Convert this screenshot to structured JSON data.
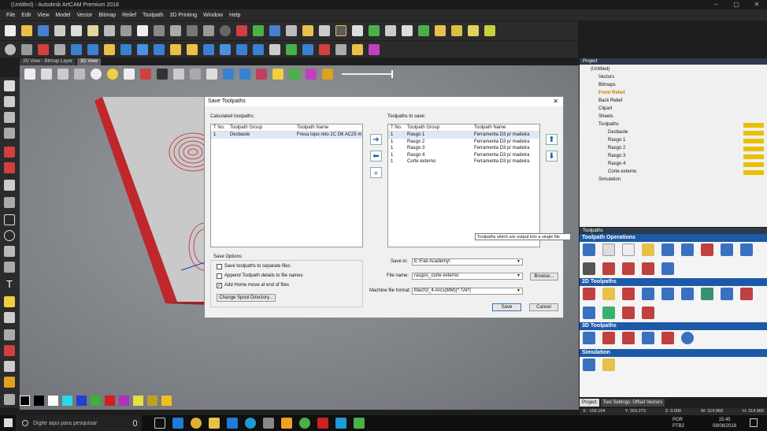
{
  "window": {
    "title": "(Untitled) - Autodesk ArtCAM Premium 2018"
  },
  "menu": [
    "File",
    "Edit",
    "View",
    "Model",
    "Vector",
    "Bitmap",
    "Relief",
    "Toolpath",
    "3D Printing",
    "Window",
    "Help"
  ],
  "view_tabs": [
    "2D View - Bitmap Layer",
    "3D View"
  ],
  "project": {
    "header": "Project",
    "items": [
      "(Untitled)",
      "Vectors",
      "Bitmaps",
      "Front Relief",
      "Back Relief",
      "Clipart",
      "Sheets",
      "Toolpaths",
      "Desbaste",
      "Rasgo 1",
      "Rasgo 2",
      "Rasgo 3",
      "Rasgo 4",
      "Corte externo",
      "Simulation"
    ]
  },
  "toolpaths_panel": {
    "header": "Toolpaths",
    "sections": [
      "Toolpath Operations",
      "2D Toolpaths",
      "3D Toolpaths",
      "Simulation"
    ]
  },
  "bottom_tabs": [
    "Project",
    "Tool Settings: Offset Vectors"
  ],
  "status": {
    "x": "X: -109.104",
    "y": "Y: 203.273",
    "z": "Z: 0.000",
    "w": "W: 314.969",
    "h": "H: 314.969"
  },
  "dialog": {
    "title": "Save Toolpaths",
    "calc_label": "Calculated toolpaths:",
    "save_label": "Toolpaths to save:",
    "columns": [
      "T No.",
      "Toolpath Group",
      "Toolpath Name"
    ],
    "calculated": [
      {
        "tno": "1",
        "group": "Desbaste",
        "name": "Fresa topo reto 2C D6 AC25 m..."
      }
    ],
    "to_save": [
      {
        "tno": "1",
        "group": "Rasgo 1",
        "name": "Ferramenta D3 p/ madeira"
      },
      {
        "tno": "1",
        "group": "Rasgo 2",
        "name": "Ferramenta D3 p/ madeira"
      },
      {
        "tno": "1",
        "group": "Rasgo 3",
        "name": "Ferramenta D3 p/ madeira"
      },
      {
        "tno": "1",
        "group": "Rasgo 4",
        "name": "Ferramenta D3 p/ madeira"
      },
      {
        "tno": "1",
        "group": "Corte externo",
        "name": "Ferramenta D3 p/ madeira"
      }
    ],
    "save_options_label": "Save Options",
    "opt1": "Save toolpaths to separate files",
    "opt2": "Append Toolpath details to file names",
    "opt3": "Add Home move at end of files",
    "spool_button": "Change Spool Directory...",
    "save_in_label": "Save in:",
    "save_in_value": "E:\\Fab Academy\\",
    "filename_label": "File name:",
    "filename_value": "rasgos_corte externo",
    "browse_button": "Browse...",
    "format_label": "Machine file format:",
    "format_value": "Mach3_4-Arcs(MM)(*.TAP)",
    "save_button": "Save",
    "cancel_button": "Cancel",
    "tooltip": "Toolpaths which are output into a single file"
  },
  "taskbar": {
    "search_placeholder": "Digite aqui para pesquisar",
    "lang": "POR",
    "kbd": "PTB2",
    "time": "15:45",
    "date": "08/06/2018"
  }
}
